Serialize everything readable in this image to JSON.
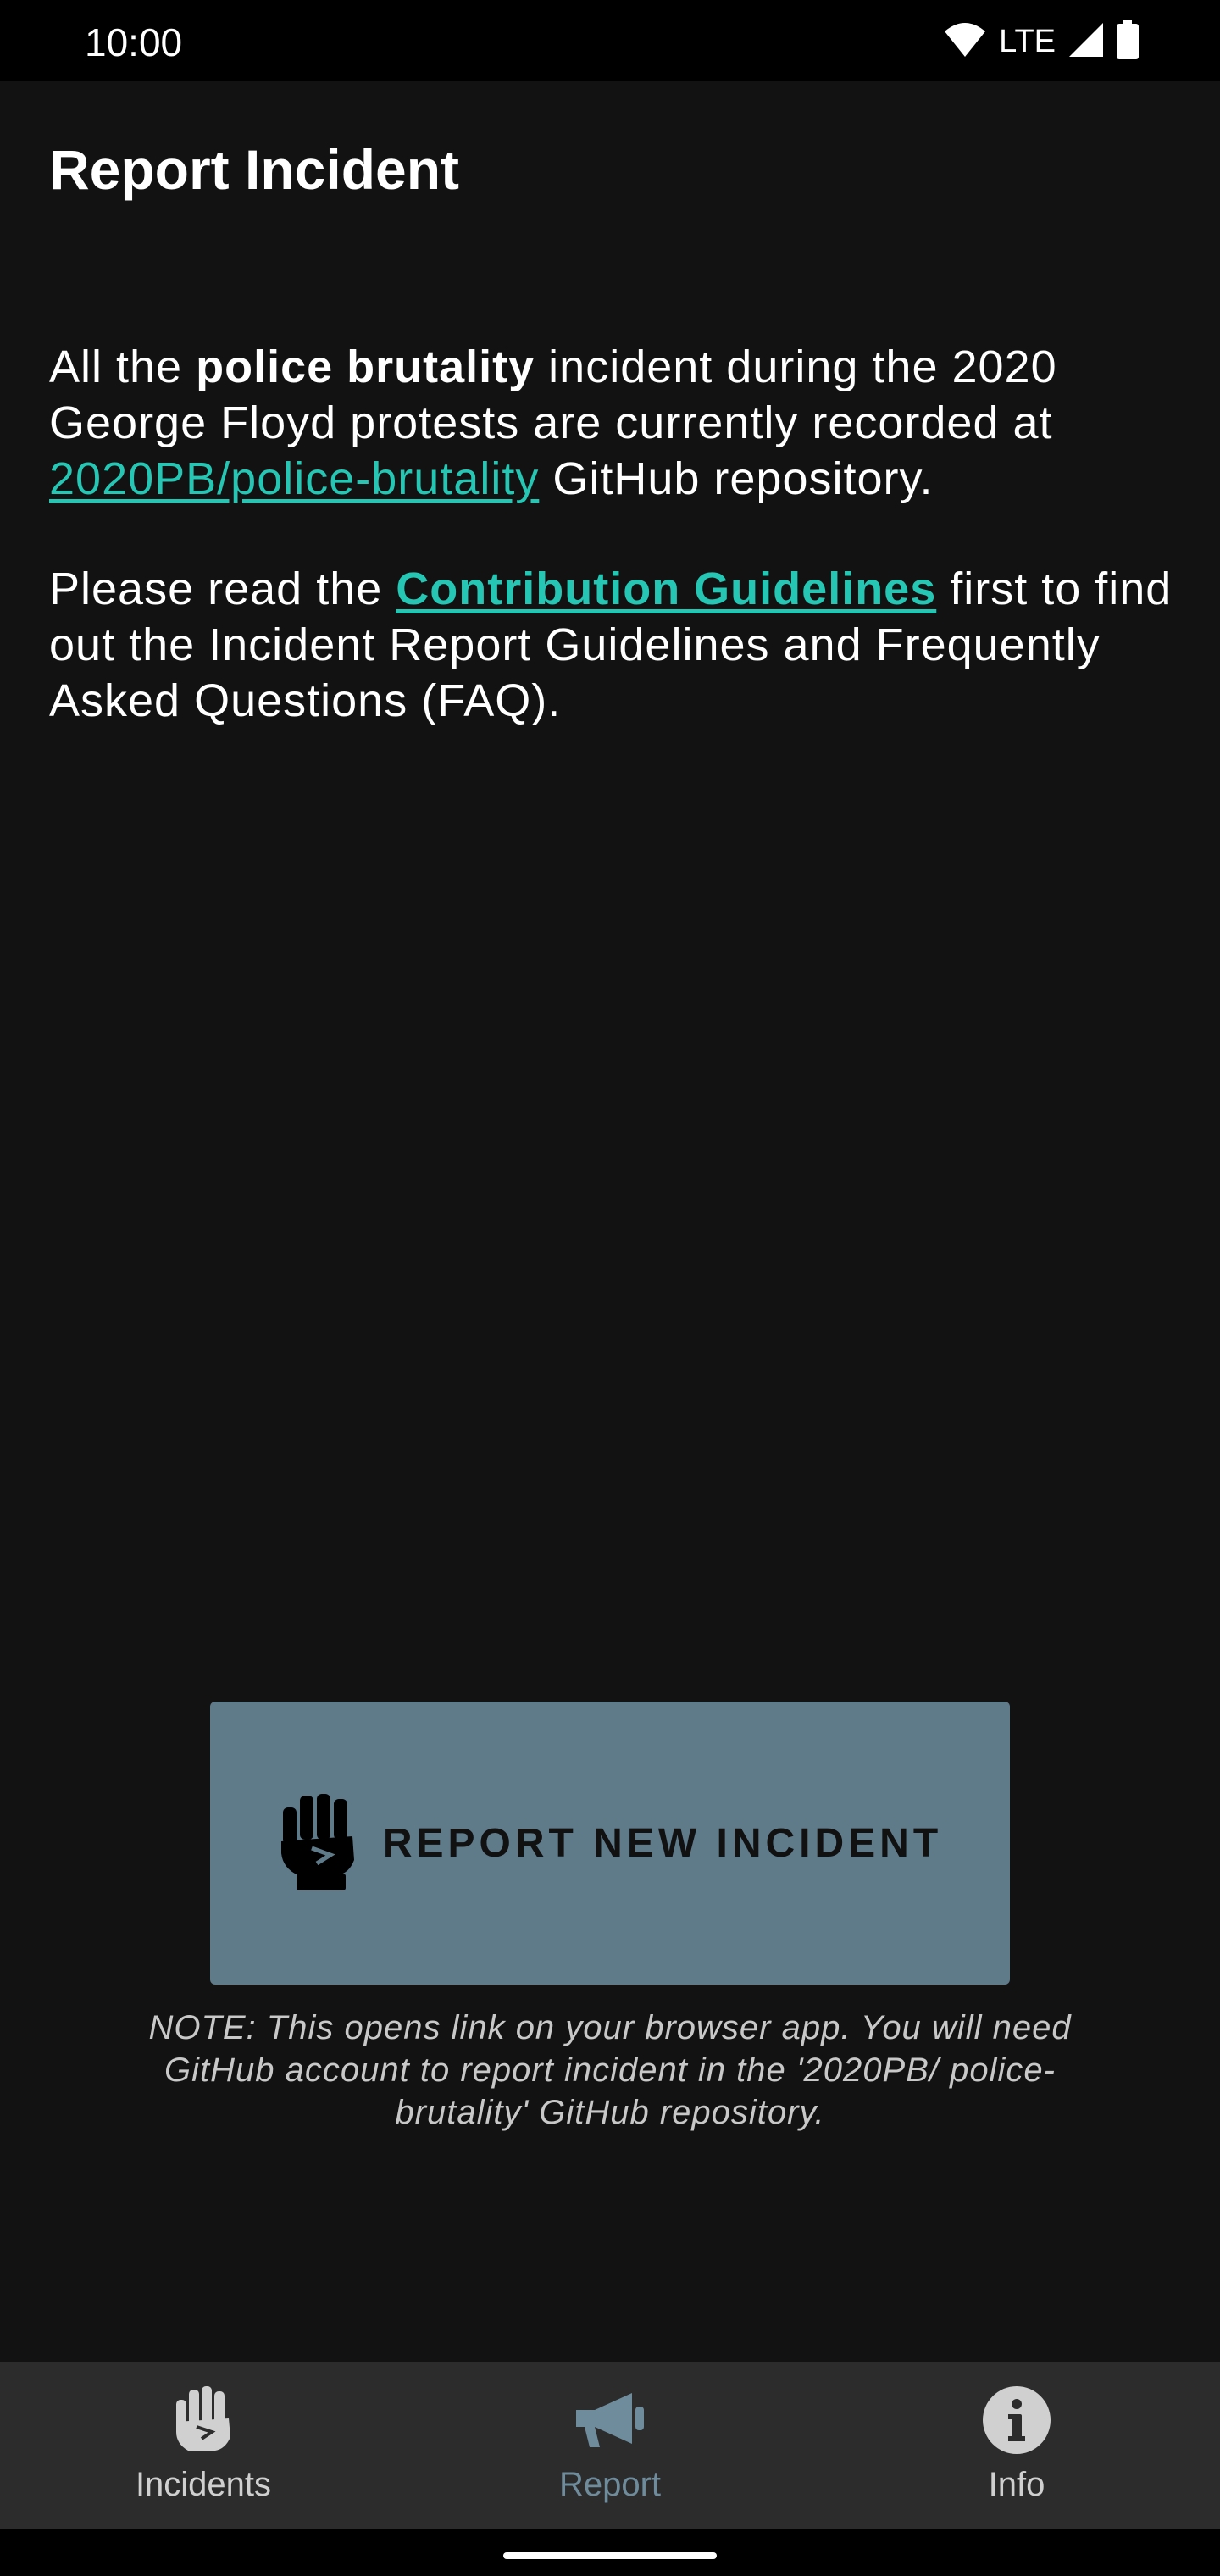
{
  "status_bar": {
    "time": "10:00",
    "network": "LTE"
  },
  "page": {
    "title": "Report Incident"
  },
  "intro": {
    "part1": "All the ",
    "bold": "police brutality",
    "part2": " incident during the 2020 George Floyd protests are currently recorded at ",
    "repo_link": "2020PB/police-brutality",
    "part3": " GitHub repository."
  },
  "guidelines": {
    "part1": "Please read the ",
    "link": "Contribution Guidelines",
    "part2": " first to find out the Incident Report Guidelines and Frequently Asked Questions (FAQ)."
  },
  "report_button": {
    "label": "REPORT NEW INCIDENT",
    "icon": "raised-fist-icon"
  },
  "note": "NOTE: This opens link on your browser app. You will need GitHub account to report incident in the '2020PB/ police-brutality' GitHub repository.",
  "bottom_nav": {
    "items": [
      {
        "label": "Incidents",
        "icon": "raised-hand-icon",
        "active": false
      },
      {
        "label": "Report",
        "icon": "megaphone-icon",
        "active": true
      },
      {
        "label": "Info",
        "icon": "info-icon",
        "active": false
      }
    ]
  },
  "colors": {
    "background": "#121212",
    "link": "#26c6b4",
    "button": "#5f7b8a",
    "nav_active": "#6f8c9c"
  }
}
